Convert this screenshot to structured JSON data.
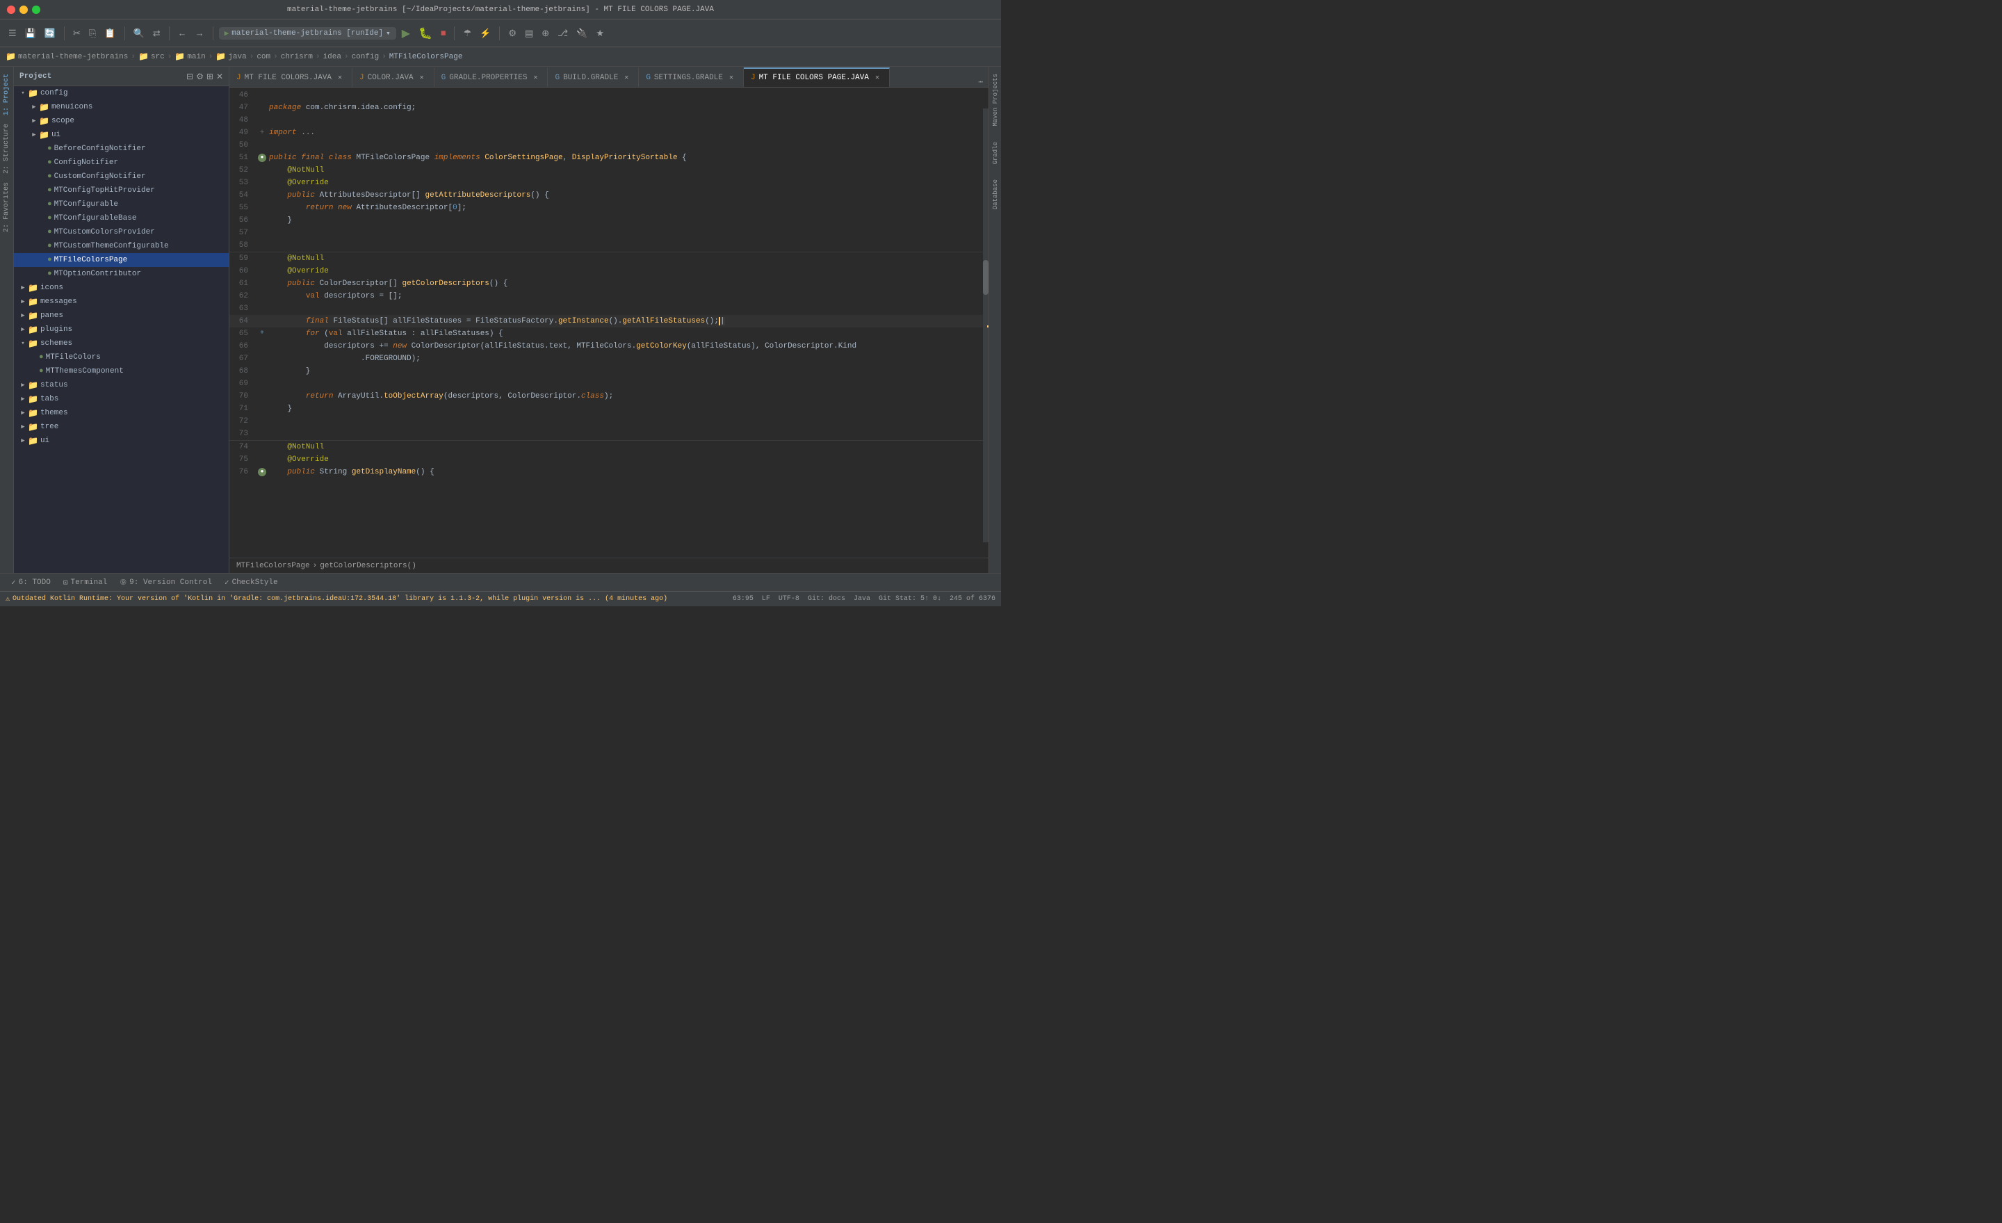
{
  "titleBar": {
    "title": "material-theme-jetbrains [~/IdeaProjects/material-theme-jetbrains] - MT FILE COLORS PAGE.JAVA"
  },
  "toolbar": {
    "runConfig": "material-theme-jetbrains [runIde]",
    "buttons": [
      "⊞",
      "≡",
      "⟲",
      "⟳",
      "✂",
      "⎘",
      "⎙",
      "🔍",
      "↔",
      "←",
      "→",
      "▦",
      "▶",
      "⏹",
      "⏭",
      "⇑",
      "⇓",
      "⏺",
      "↺",
      "↻",
      "⚙",
      "▤",
      "⊕",
      "☰",
      "⚡",
      "⊞",
      "⊟",
      "☆"
    ]
  },
  "breadcrumb": {
    "items": [
      "material-theme-jetbrains",
      "src",
      "main",
      "java",
      "com",
      "chrisrm",
      "idea",
      "config",
      "MTFileColorsPage"
    ]
  },
  "projectTree": {
    "title": "Project",
    "items": [
      {
        "id": "config",
        "label": "config",
        "type": "folder",
        "level": 0,
        "expanded": true
      },
      {
        "id": "menuicons",
        "label": "menuicons",
        "type": "folder",
        "level": 1
      },
      {
        "id": "scope",
        "label": "scope",
        "type": "folder",
        "level": 1
      },
      {
        "id": "ui",
        "label": "ui",
        "type": "folder",
        "level": 1
      },
      {
        "id": "BeforeConfigNotifier",
        "label": "BeforeConfigNotifier",
        "type": "java",
        "level": 2
      },
      {
        "id": "ConfigNotifier",
        "label": "ConfigNotifier",
        "type": "java",
        "level": 2
      },
      {
        "id": "CustomConfigNotifier",
        "label": "CustomConfigNotifier",
        "type": "java",
        "level": 2
      },
      {
        "id": "MTConfigTopHitProvider",
        "label": "MTConfigTopHitProvider",
        "type": "java",
        "level": 2
      },
      {
        "id": "MTConfigurable",
        "label": "MTConfigurable",
        "type": "java",
        "level": 2
      },
      {
        "id": "MTConfigurableBase",
        "label": "MTConfigurableBase",
        "type": "java",
        "level": 2
      },
      {
        "id": "MTCustomColorsProvider",
        "label": "MTCustomColorsProvider",
        "type": "java",
        "level": 2
      },
      {
        "id": "MTCustomThemeConfigurable",
        "label": "MTCustomThemeConfigurable",
        "type": "java",
        "level": 2
      },
      {
        "id": "MTFileColorsPage",
        "label": "MTFileColorsPage",
        "type": "java",
        "level": 2,
        "selected": true
      },
      {
        "id": "MTOptionContributor",
        "label": "MTOptionContributor",
        "type": "java",
        "level": 2
      },
      {
        "id": "icons",
        "label": "icons",
        "type": "folder",
        "level": 0
      },
      {
        "id": "messages",
        "label": "messages",
        "type": "folder",
        "level": 0
      },
      {
        "id": "panes",
        "label": "panes",
        "type": "folder",
        "level": 0
      },
      {
        "id": "plugins",
        "label": "plugins",
        "type": "folder",
        "level": 0
      },
      {
        "id": "schemes",
        "label": "schemes",
        "type": "folder",
        "level": 0,
        "expanded": true
      },
      {
        "id": "MTFileColors",
        "label": "MTFileColors",
        "type": "java",
        "level": 1
      },
      {
        "id": "MTThemesComponent",
        "label": "MTThemesComponent",
        "type": "java",
        "level": 1
      },
      {
        "id": "status",
        "label": "status",
        "type": "folder",
        "level": 0
      },
      {
        "id": "tabs",
        "label": "tabs",
        "type": "folder",
        "level": 0
      },
      {
        "id": "themes",
        "label": "themes",
        "type": "folder",
        "level": 0
      },
      {
        "id": "tree",
        "label": "tree",
        "type": "folder",
        "level": 0
      },
      {
        "id": "ui2",
        "label": "ui",
        "type": "folder",
        "level": 0
      }
    ]
  },
  "tabs": [
    {
      "id": "MTFileColors",
      "label": "MT FILE COLORS.JAVA",
      "icon": "java",
      "active": false
    },
    {
      "id": "ColorJava",
      "label": "COLOR.JAVA",
      "icon": "java",
      "active": false
    },
    {
      "id": "GradleProperties",
      "label": "GRADLE.PROPERTIES",
      "icon": "gradle",
      "active": false
    },
    {
      "id": "BuildGradle",
      "label": "BUILD.GRADLE",
      "icon": "gradle",
      "active": false
    },
    {
      "id": "SettingsGradle",
      "label": "SETTINGS.GRADLE",
      "icon": "gradle",
      "active": false
    },
    {
      "id": "MTFileColorsPage",
      "label": "MT FILE COLORS PAGE.JAVA",
      "icon": "java",
      "active": true
    }
  ],
  "code": {
    "lines": [
      {
        "num": 46,
        "code": ""
      },
      {
        "num": 47,
        "code": "package com.chrisrm.idea.config;"
      },
      {
        "num": 48,
        "code": ""
      },
      {
        "num": 49,
        "code": "+ import ..."
      },
      {
        "num": 50,
        "code": ""
      },
      {
        "num": 51,
        "code": "public final class MTFileColorsPage implements ColorSettingsPage, DisplayPrioritySortable {"
      },
      {
        "num": 52,
        "code": "    @NotNull"
      },
      {
        "num": 53,
        "code": "    @Override"
      },
      {
        "num": 54,
        "code": "    public AttributesDescriptor[] getAttributeDescriptors() {"
      },
      {
        "num": 55,
        "code": "        return new AttributesDescriptor[0];"
      },
      {
        "num": 56,
        "code": "    }"
      },
      {
        "num": 57,
        "code": ""
      },
      {
        "num": 58,
        "code": ""
      },
      {
        "num": 59,
        "code": "    @NotNull"
      },
      {
        "num": 60,
        "code": "    @Override"
      },
      {
        "num": 61,
        "code": "    public ColorDescriptor[] getColorDescriptors() {"
      },
      {
        "num": 62,
        "code": "        val descriptors = [];"
      },
      {
        "num": 63,
        "code": ""
      },
      {
        "num": 64,
        "code": "        final FileStatus[] allFileStatuses = FileStatusFactory.getInstance().getAllFileStatuses();"
      },
      {
        "num": 65,
        "code": "        for (val allFileStatus : allFileStatuses) {"
      },
      {
        "num": 66,
        "code": "            descriptors += new ColorDescriptor(allFileStatus.text, MTFileColors.getColorKey(allFileStatus), ColorDescriptor.Kind"
      },
      {
        "num": 67,
        "code": "                    .FOREGROUND);"
      },
      {
        "num": 68,
        "code": "        }"
      },
      {
        "num": 69,
        "code": ""
      },
      {
        "num": 70,
        "code": "        return ArrayUtil.toObjectArray(descriptors, ColorDescriptor.class);"
      },
      {
        "num": 71,
        "code": "    }"
      },
      {
        "num": 72,
        "code": ""
      },
      {
        "num": 73,
        "code": ""
      },
      {
        "num": 74,
        "code": "    @NotNull"
      },
      {
        "num": 75,
        "code": "    @Override"
      },
      {
        "num": 76,
        "code": "    public String getDisplayName() {"
      }
    ]
  },
  "bottomTabs": [
    {
      "id": "todo",
      "label": "6: TODO",
      "icon": "✓",
      "active": false
    },
    {
      "id": "terminal",
      "label": "Terminal",
      "icon": "⊡",
      "active": false
    },
    {
      "id": "vcs",
      "label": "9: Version Control",
      "icon": "⑨",
      "active": false
    },
    {
      "id": "checkstyle",
      "label": "CheckStyle",
      "icon": "✓",
      "active": false
    }
  ],
  "statusBar": {
    "warning": "Outdated Kotlin Runtime: Your version of 'Kotlin in 'Gradle: com.jetbrains.ideaU:172.3544.18' library is 1.1.3-2, while plugin version is ... (4 minutes ago)",
    "position": "63:95",
    "lineEnding": "LF",
    "encoding": "UTF-8",
    "git": "Git: docs",
    "java": "Java",
    "stat": "Git Stat: 5↑ 0↓",
    "lines": "245 of 6376"
  },
  "rightSidebar": {
    "labels": [
      "Maven Projects",
      "Gradle",
      "Database"
    ]
  },
  "editorBreadcrumb": {
    "items": [
      "MTFileColorsPage",
      "getColorDescriptors()"
    ]
  }
}
